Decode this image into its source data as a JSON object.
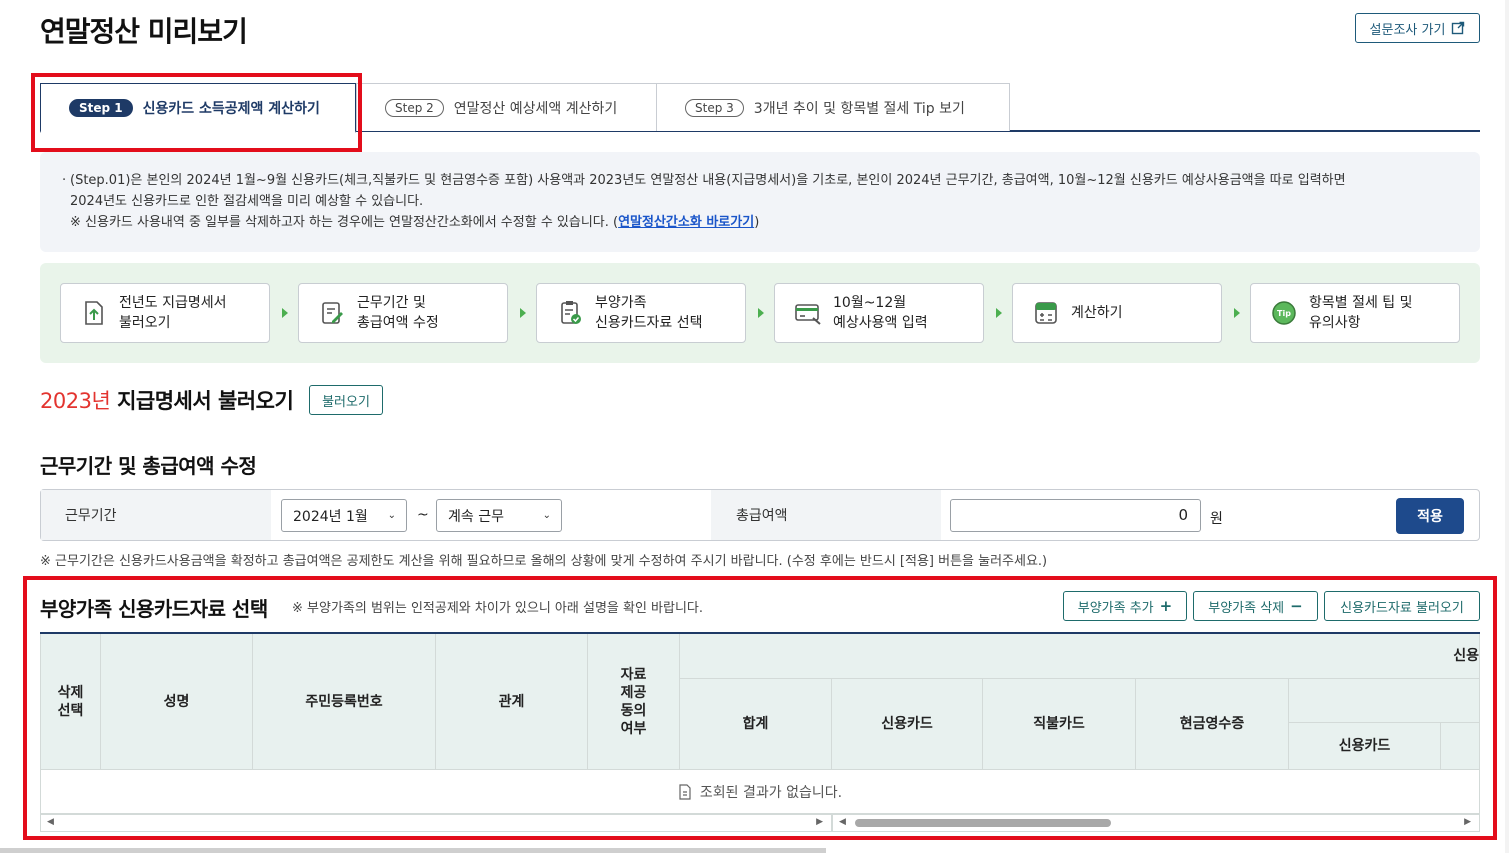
{
  "page": {
    "title": "연말정산 미리보기",
    "survey_button": "설문조사 가기"
  },
  "tabs": [
    {
      "step": "Step 1",
      "label": "신용카드 소득공제액 계산하기",
      "active": true
    },
    {
      "step": "Step 2",
      "label": "연말정산 예상세액 계산하기",
      "active": false
    },
    {
      "step": "Step 3",
      "label": "3개년 추이 및 항목별 절세 Tip 보기",
      "active": false
    }
  ],
  "info": {
    "line1": "(Step.01)은 본인의 2024년 1월~9월 신용카드(체크,직불카드 및 현금영수증 포함) 사용액과 2023년도 연말정산 내용(지급명세서)을 기초로, 본인이 2024년 근무기간, 총급여액, 10월~12월 신용카드 예상사용금액을 따로 입력하면",
    "line2": "2024년도 신용카드로 인한 절감세액을 미리 예상할 수 있습니다.",
    "note_prefix": "※ 신용카드 사용내역 중 일부를 삭제하고자 하는 경우에는 연말정산간소화에서 수정할 수 있습니다. (",
    "note_link": "연말정산간소화 바로가기",
    "note_suffix": ")"
  },
  "flow_steps": [
    {
      "line1": "전년도 지급명세서",
      "line2": "불러오기",
      "icon": "document-upload-icon"
    },
    {
      "line1": "근무기간 및",
      "line2": "총급여액 수정",
      "icon": "edit-document-icon"
    },
    {
      "line1": "부양가족",
      "line2": "신용카드자료 선택",
      "icon": "clipboard-check-icon"
    },
    {
      "line1": "10월~12월",
      "line2": "예상사용액 입력",
      "icon": "card-input-icon"
    },
    {
      "line1": "계산하기",
      "line2": "",
      "icon": "calculator-icon"
    },
    {
      "line1": "항목별 절세 팁 및",
      "line2": "유의사항",
      "icon": "tip-icon"
    }
  ],
  "statement": {
    "year": "2023년",
    "title": " 지급명세서 불러오기",
    "load_button": "불러오기"
  },
  "work": {
    "heading": "근무기간 및 총급여액 수정",
    "period_label": "근무기간",
    "start_value": "2024년 1월",
    "tilde": "~",
    "end_value": "계속 근무",
    "salary_label": "총급여액",
    "salary_value": "0",
    "unit": "원",
    "apply_button": "적용",
    "note": "※ 근무기간은 신용카드사용금액을 확정하고 총급여액은 공제한도 계산을 위해 필요하므로 올해의 상황에 맞게 수정하여 주시기 바랍니다. (수정 후에는 반드시 [적용] 버튼을 눌러주세요.)"
  },
  "dependents": {
    "heading": "부양가족 신용카드자료 선택",
    "note": "※ 부양가족의 범위는 인적공제와 차이가 있으니 아래 설명을 확인 바랍니다.",
    "add_button": "부양가족 추가",
    "delete_button": "부양가족 삭제",
    "load_button": "신용카드자료 불러오기",
    "columns": {
      "delete_select": "삭제\n선택",
      "name": "성명",
      "rrn": "주민등록번호",
      "relation": "관계",
      "consent": "자료\n제공\n동의\n여부",
      "group_top": "신용",
      "total": "합계",
      "credit_card": "신용카드",
      "debit_card": "직불카드",
      "cash_receipt": "현금영수증",
      "sub_credit_card": "신용카드"
    },
    "empty_message": "조회된 결과가 없습니다."
  }
}
